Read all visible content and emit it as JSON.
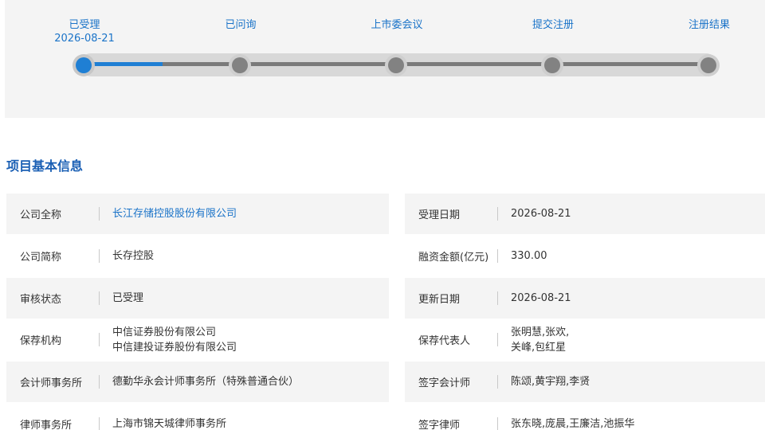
{
  "progress": {
    "steps": [
      {
        "label": "已受理",
        "date": "2026-08-21",
        "active": true
      },
      {
        "label": "已问询",
        "date": "",
        "active": false
      },
      {
        "label": "上市委会议",
        "date": "",
        "active": false
      },
      {
        "label": "提交注册",
        "date": "",
        "active": false
      },
      {
        "label": "注册结果",
        "date": "",
        "active": false
      }
    ]
  },
  "section": {
    "title": "项目基本信息"
  },
  "info_left": [
    {
      "label": "公司全称",
      "value": [
        "长江存储控股股份有限公司"
      ]
    },
    {
      "label": "公司简称",
      "value": [
        "长存控股"
      ]
    },
    {
      "label": "审核状态",
      "value": [
        "已受理"
      ]
    },
    {
      "label": "保荐机构",
      "value": [
        "中信证券股份有限公司",
        "中信建投证券股份有限公司"
      ]
    },
    {
      "label": "会计师事务所",
      "value": [
        "德勤华永会计师事务所（特殊普通合伙）"
      ]
    },
    {
      "label": "律师事务所",
      "value": [
        "上海市锦天城律师事务所"
      ]
    }
  ],
  "info_right": [
    {
      "label": "受理日期",
      "value": [
        "2026-08-21"
      ]
    },
    {
      "label": "融资金额(亿元)",
      "value": [
        "330.00"
      ]
    },
    {
      "label": "更新日期",
      "value": [
        "2026-08-21"
      ]
    },
    {
      "label": "保荐代表人",
      "value": [
        "张明慧,张欢,",
        "关峰,包红星"
      ]
    },
    {
      "label": "签字会计师",
      "value": [
        "陈颂,黄宇翔,李贤"
      ]
    },
    {
      "label": "签字律师",
      "value": [
        "张东晓,庞晨,王廉洁,池振华"
      ]
    }
  ],
  "colors": {
    "accent": "#1f7fd4",
    "link": "#1a73c8",
    "title": "#1a5fb4"
  }
}
